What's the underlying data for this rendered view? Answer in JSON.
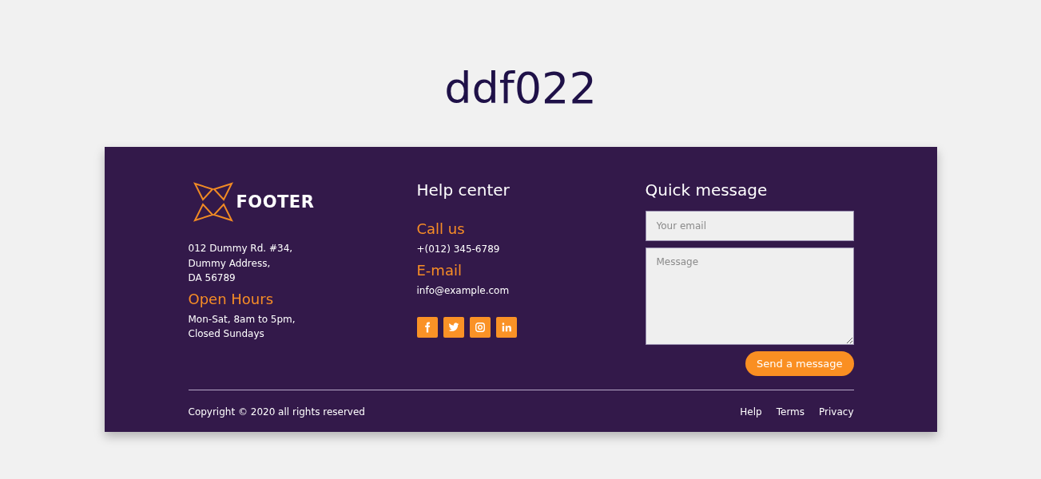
{
  "page_title": "ddf022",
  "brand": {
    "name": "FOOTER",
    "address": [
      "012 Dummy Rd. #34,",
      "Dummy Address,",
      "DA 56789"
    ],
    "hours_heading": "Open Hours",
    "hours": [
      "Mon-Sat, 8am to 5pm,",
      "Closed Sundays"
    ]
  },
  "help_center": {
    "heading": "Help center",
    "sections": [
      {
        "heading": "Call us",
        "value": "+(012) 345-6789"
      },
      {
        "heading": "E-mail",
        "value": "info@example.com"
      }
    ],
    "socials": [
      {
        "kind": "facebook"
      },
      {
        "kind": "twitter"
      },
      {
        "kind": "instagram"
      },
      {
        "kind": "linkedin"
      }
    ]
  },
  "quick_message": {
    "heading": "Quick message",
    "email": {
      "placeholder": "Your email"
    },
    "message": {
      "placeholder": "Message"
    },
    "button": "Send a message"
  },
  "bottom": {
    "copyright": "Copyright © 2020 all rights reserved",
    "links": [
      "Help",
      "Terms",
      "Privacy"
    ]
  }
}
